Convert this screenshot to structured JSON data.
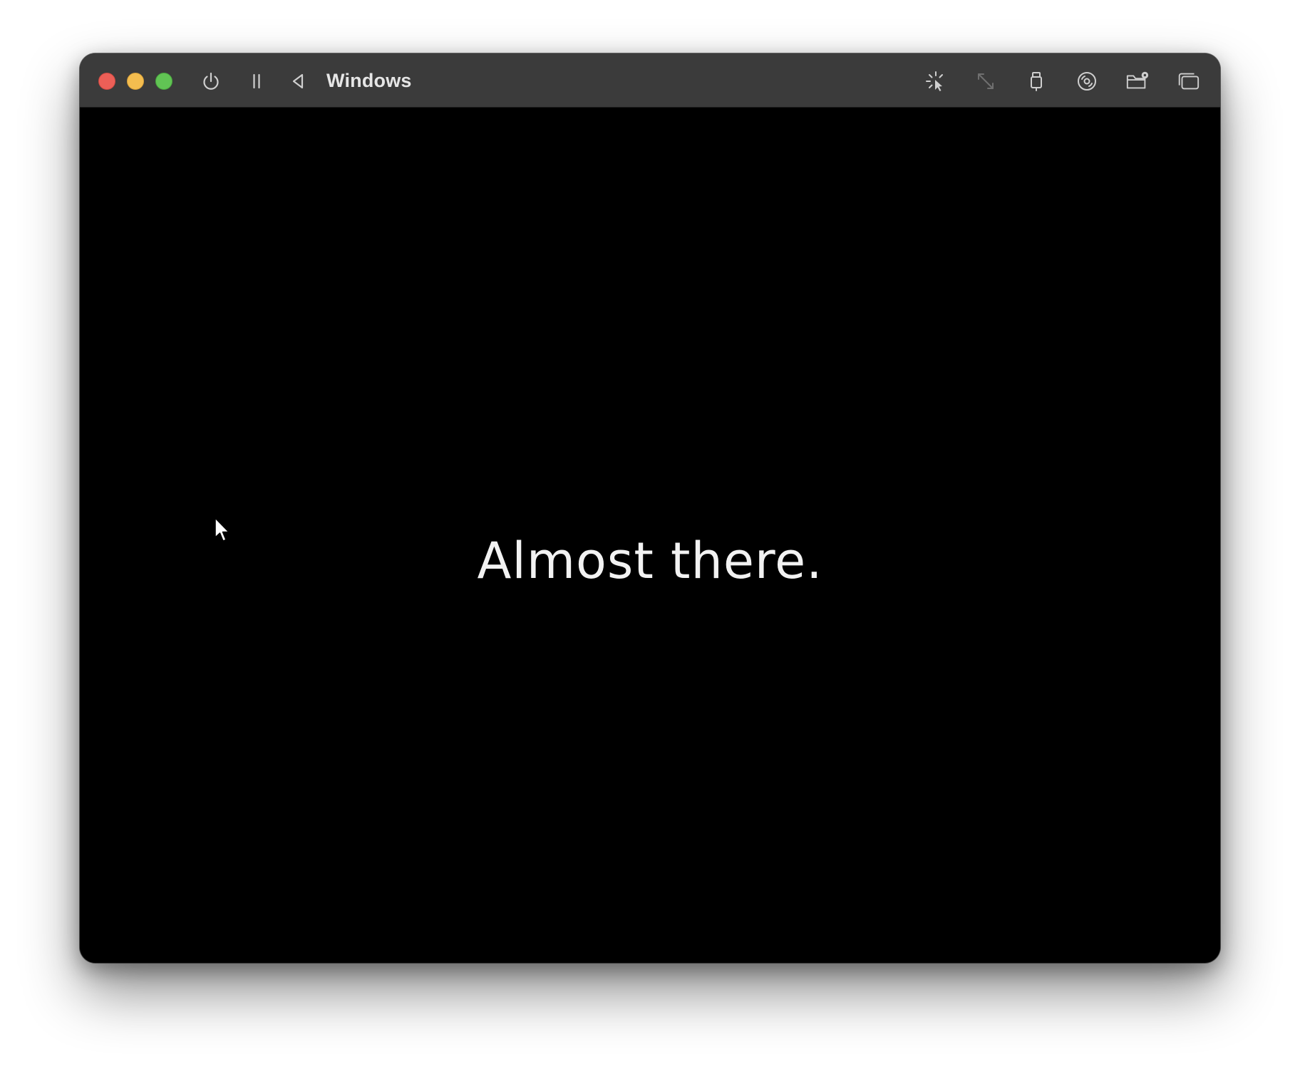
{
  "window": {
    "title": "Windows"
  },
  "toolbar": {
    "left_icons": [
      "power-icon",
      "pause-icon",
      "back-icon"
    ],
    "right_icons": [
      "capture-input-icon",
      "resize-icon",
      "usb-icon",
      "disc-icon",
      "shared-folder-icon",
      "windows-icon"
    ]
  },
  "screen": {
    "message": "Almost there."
  },
  "colors": {
    "titlebar": "#3b3b3b",
    "close": "#ec5f57",
    "minimize": "#f4bd4f",
    "zoom": "#61c454",
    "screen_bg": "#000000",
    "text": "#f2f2f2"
  }
}
